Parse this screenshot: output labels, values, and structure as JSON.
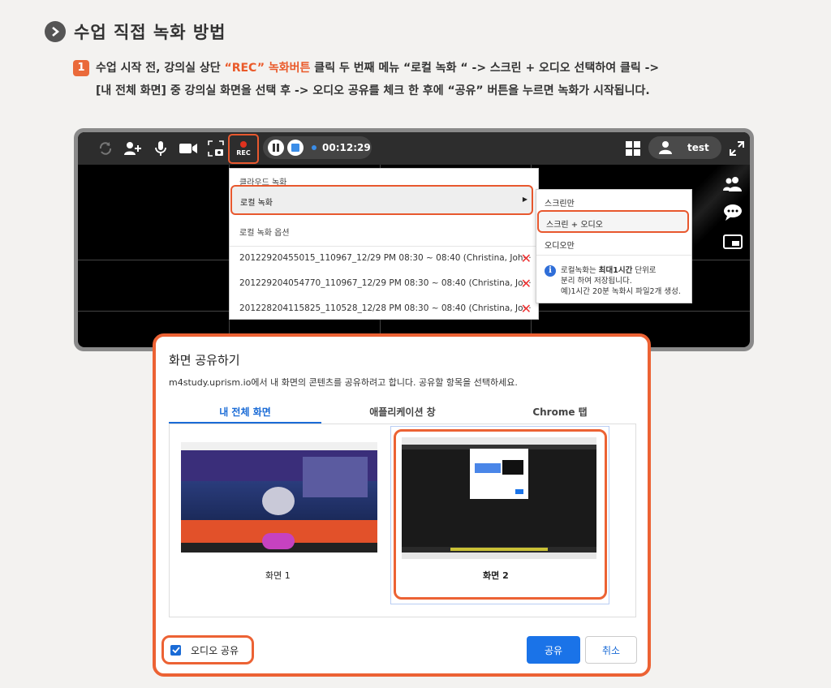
{
  "heading": {
    "title": "수업 직접 녹화 방법"
  },
  "step": {
    "number": "1",
    "line1_a": "수업 시작 전, 강의실 상단 ",
    "line1_hl": "“REC” 녹화버튼",
    "line1_b": " 클릭 두 번째 메뉴 “로컬 녹화 “ -> 스크린 + 오디오 선택하여 클릭 ->",
    "line2": "[내 전체 화면] 중 강의실 화면을 선택 후 -> 오디오 공유를  체크 한 후에 “공유” 버튼을 누르면 녹화가 시작됩니다."
  },
  "toolbar": {
    "rec_label": "REC",
    "timer": "00:12:29",
    "user_name": "test"
  },
  "rec_menu": {
    "cloud_label": "클라우드 녹화",
    "local_label": "로컬 녹화",
    "options_label": "로컬 녹화 옵션",
    "files": [
      "20122920455015_110967_12/29 PM 08:30 ~ 08:40 (Christina, Joh···",
      "20122920405477​0_110967_12/29 PM 08:30 ~ 08:40 (Christina, Jo···",
      "20122820411582​5_110528_12/28 PM 08:30 ~ 08:40 (Christina, Jo···"
    ]
  },
  "sub_menu": {
    "screen_only": "스크린만",
    "screen_audio": "스크린 + 오디오",
    "audio_only": "오디오만",
    "info_line1_a": "로컬녹화는 ",
    "info_line1_b": "최대1시간",
    "info_line1_c": " 단위로",
    "info_line2": "분리 하여 저장됩니다.",
    "info_line3": "예)1시간 20분 녹화시 파일2개 생성."
  },
  "share_dialog": {
    "title": "화면 공유하기",
    "description": "m4study.uprism.io에서 내 화면의 콘텐츠를 공유하려고 합니다. 공유할 항목을 선택하세요.",
    "tabs": [
      "내 전체 화면",
      "애플리케이션 창",
      "Chrome 탭"
    ],
    "screen1": "화면 1",
    "screen2": "화면 2",
    "audio_share": "오디오 공유",
    "share_btn": "공유",
    "cancel_btn": "취소"
  },
  "colors": {
    "accent": "#ec6234",
    "blue": "#1a73e8",
    "rec_red": "#e0321e"
  }
}
